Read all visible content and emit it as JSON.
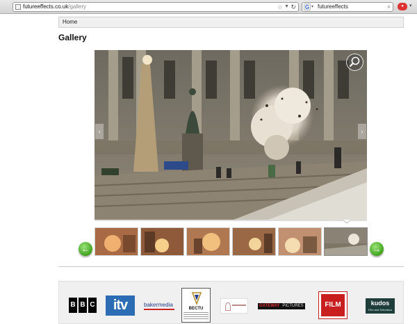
{
  "browser": {
    "url_host": "futureeffects.co.uk",
    "url_path": "/gallery",
    "search_engine_icon": "google-icon",
    "search_engine_letter": "G",
    "search_query": "futureeffects"
  },
  "nav": {
    "home_label": "Home"
  },
  "page": {
    "title": "Gallery"
  },
  "gallery": {
    "zoom_icon": "magnifier-icon",
    "prev_icon": "‹",
    "next_icon": "›",
    "round_prev_icon": "←",
    "round_next_icon": "→",
    "thumbnail_count": 6,
    "active_thumbnail": 6
  },
  "logos": {
    "bbc": [
      "B",
      "B",
      "C"
    ],
    "itv": "itv",
    "baker": "bakermedia",
    "bectu": "BECTU",
    "gateway_left": "GATEWAY",
    "gateway_right": "PICTURES",
    "film": "FILM",
    "kudos_title": "kudos",
    "kudos_sub": "Film and Television"
  },
  "colors": {
    "accent_green": "#3fa31d",
    "itv_blue": "#2b6cb5",
    "film_red": "#c81e1e",
    "kudos_green": "#1f3d3a"
  }
}
